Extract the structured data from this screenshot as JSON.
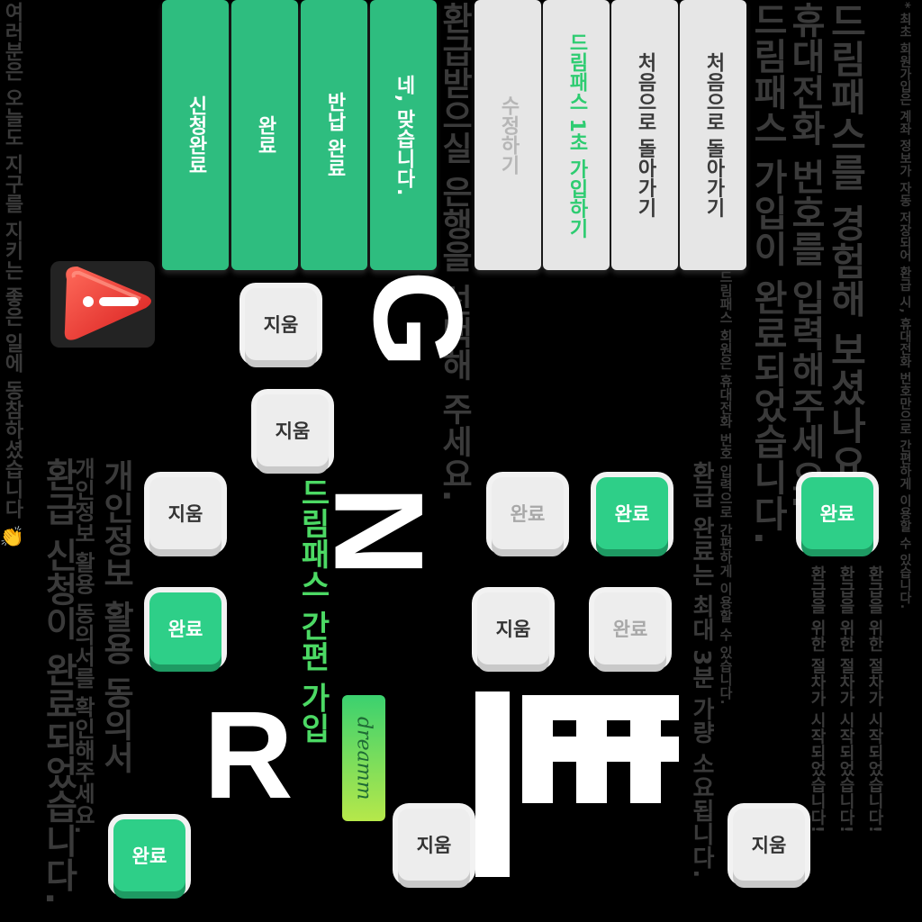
{
  "columns": {
    "right_note": "* 최초 회원가입은 계좌 정보가 자동 저장되어 환급 시, 휴대전화 번호만으로 간편하게 이용할 수 있습니다.",
    "right_head_1": "드림패스를 경험해 보셨나요?",
    "right_head_2": "휴대전화 번호를 입력해주세요.",
    "right_head_3": "드림패스 가입이 완료되었습니다.",
    "right_small": "드림패스 회원은 휴대전화 번호 입력으로 간편하게 이용할 수 있습니다.",
    "right_mid": "환급 완료는 최대 3분 가량 소요됩니다.",
    "proc_1": "환급을 위한 절차가 시작되었습니다!",
    "proc_2": "환급을 위한 절차가 시작되었습니다!",
    "proc_3": "환급을 위한 절차가 시작되었습니다!",
    "center_head": "환급받으실 은행을 선택해 주세요.",
    "left_small": "여러분은 오늘도 지구를 지키는 좋은 일에 동참하셨습니다 👏",
    "left_head_1": "개인정보 활용 동의서",
    "left_head_2": "개인정보 활용 동의서를 확인해주세요.",
    "left_head_3": "환급 신청이 완료되었습니다."
  },
  "tall_buttons": [
    {
      "label": "신청완료"
    },
    {
      "label": "완료"
    },
    {
      "label": "반납 완료"
    },
    {
      "label": "네, 맞습니다."
    },
    {
      "label": "수정하기"
    },
    {
      "label": "드림패스 1초 가입하기"
    },
    {
      "label": "처음으로 돌아가기"
    },
    {
      "label": "처음으로 돌아가기"
    }
  ],
  "keys": {
    "delete": "지움",
    "done": "완료"
  },
  "brand": {
    "name": "드림패스 간편 가입",
    "logo_text": "dreamm",
    "letter_g": "G",
    "letter_n": "N",
    "letter_r": "R",
    "letter_e": "E"
  },
  "colors": {
    "accent": "#2ebd7f",
    "key_green": "#2ecf88",
    "highlight_text": "#2ecc71",
    "warning": "#e53935"
  },
  "icons": [
    "warning-icon",
    "clap-icon",
    "dreamm-logo-icon"
  ]
}
